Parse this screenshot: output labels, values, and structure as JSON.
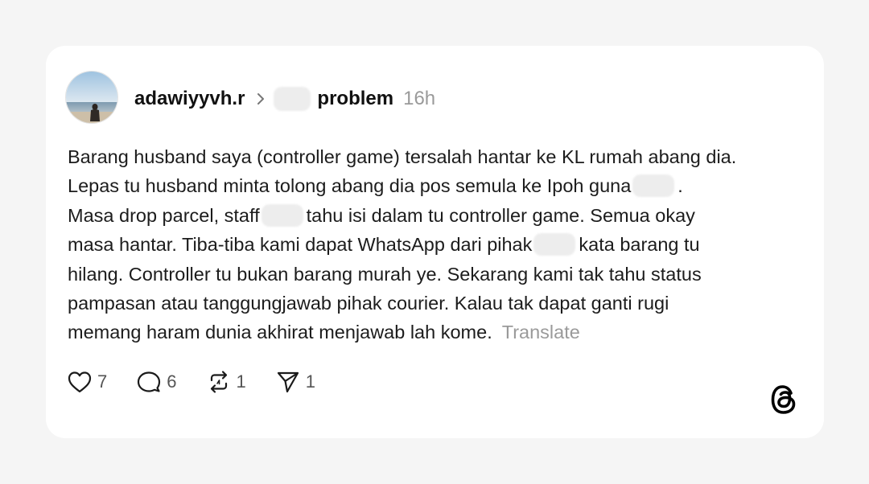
{
  "post": {
    "username": "adawiyyvh.r",
    "topic": "problem",
    "time": "16h",
    "body_lines": [
      "Barang husband saya (controller game) tersalah hantar ke KL rumah abang dia.",
      "Lepas tu husband minta tolong abang dia pos semula ke Ipoh guna",
      ".",
      "Masa drop parcel, staff",
      "tahu isi dalam tu controller game. Semua okay",
      "masa hantar. Tiba-tiba kami dapat WhatsApp dari pihak",
      "kata barang tu",
      "hilang. Controller tu bukan barang murah ye. Sekarang kami tak tahu status",
      "pampasan atau tanggungjawab pihak courier. Kalau tak dapat ganti rugi",
      "memang haram dunia akhirat menjawab lah kome."
    ],
    "translate_label": "Translate"
  },
  "actions": {
    "likes": "7",
    "comments": "6",
    "reposts": "1",
    "shares": "1"
  },
  "icons": {
    "like": "heart-icon",
    "comment": "comment-bubble-icon",
    "repost": "repost-icon",
    "share": "send-icon",
    "brand": "threads-logo"
  },
  "colors": {
    "page_bg": "#f5f5f5",
    "card_bg": "#ffffff",
    "text": "#1c1c1c",
    "muted": "#9a9a9a"
  }
}
